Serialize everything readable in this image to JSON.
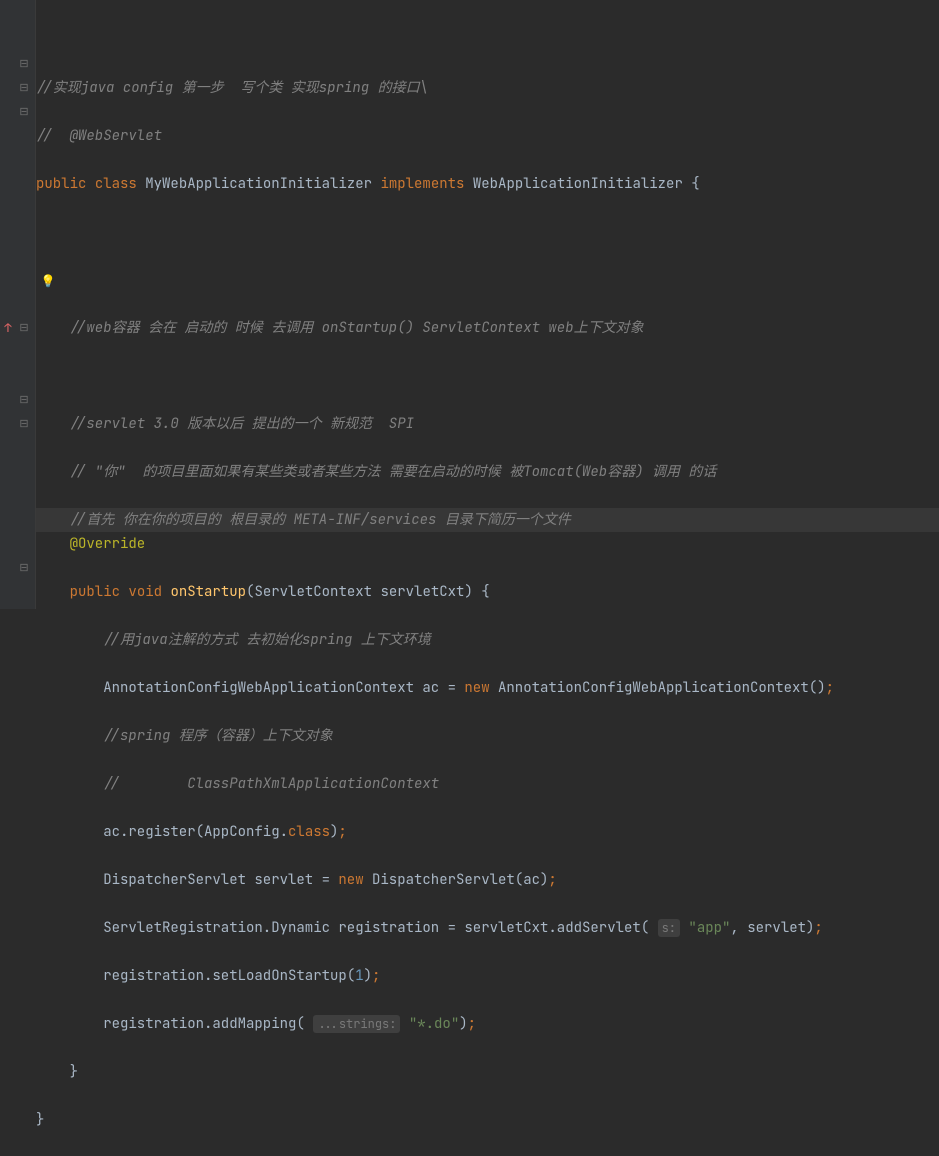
{
  "colors": {
    "background": "#2b2b2b",
    "gutter": "#313335",
    "foreground": "#a9b7c6",
    "comment": "#808080",
    "keyword": "#cc7832",
    "annotation": "#bbb529",
    "string": "#6a8759",
    "number": "#6897bb",
    "method": "#ffc66d",
    "bulb": "#f0c74a"
  },
  "code": {
    "l1": "//实现java config 第一步  写个类 实现spring 的接口\\",
    "l2": "//  @WebServlet",
    "l3_public": "public",
    "l3_class": "class",
    "l3_name": "MyWebApplicationInitializer",
    "l3_implements": "implements",
    "l3_iface": "WebApplicationInitializer {",
    "l6": "//web容器 会在 启动的 时候 去调用 onStartup() ServletContext web上下文对象",
    "l8": "//servlet 3.0 版本以后 提出的一个 新规范  SPI",
    "l9": "// \"你\"  的项目里面如果有某些类或者某些方法 需要在启动的时候 被Tomcat(Web容器) 调用 的话",
    "l10": "//首先 你在你的项目的 根目录的 META-INF/services 目录下简历一个文件",
    "l11_override": "@Override",
    "l12_public": "public",
    "l12_void": "void",
    "l12_method": "onStartup",
    "l12_params": "(ServletContext servletCxt) {",
    "l13": "//用java注解的方式 去初始化spring 上下文环境",
    "l14_a": "AnnotationConfigWebApplicationContext ac = ",
    "l14_new": "new",
    "l14_b": " AnnotationConfigWebApplicationContext()",
    "l15": "//spring 程序（容器）上下文对象",
    "l16": "//        ClassPathXmlApplicationContext",
    "l17_a": "ac.register(AppConfig.",
    "l17_class": "class",
    "l17_b": ")",
    "l18_a": "DispatcherServlet servlet = ",
    "l18_new": "new",
    "l18_b": " DispatcherServlet(ac)",
    "l19_a": "ServletRegistration.Dynamic registration = servletCxt.addServlet(",
    "l19_hint": "s:",
    "l19_str": " \"app\"",
    "l19_b": ", servlet)",
    "l20_a": "registration.setLoadOnStartup(",
    "l20_num": "1",
    "l20_b": ")",
    "l21_a": "registration.addMapping(",
    "l21_hint": "...strings:",
    "l21_str": " \"*.do\"",
    "l21_b": ")",
    "close1": "}",
    "close2": "}"
  },
  "icons": {
    "fold_minus": "⊟",
    "fold_plus": "⊞",
    "bulb": "💡",
    "arrow": "↑"
  }
}
